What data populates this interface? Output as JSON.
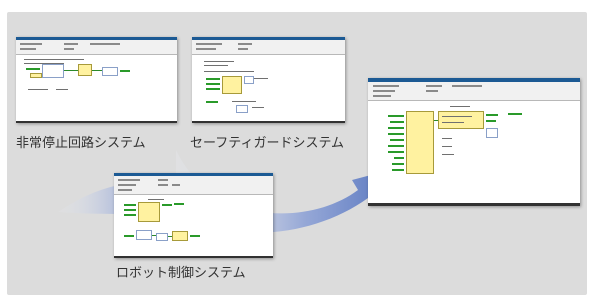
{
  "labels": {
    "emergency_stop": "非常停止回路システム",
    "safety_guard": "セーフティガードシステム",
    "robot_control": "ロボット制御システム"
  },
  "colors": {
    "panel_background": "#dcdcdc",
    "arrow_gradient_start": "#e8ecf6",
    "arrow_gradient_end": "#5a78c0",
    "function_block": "#fff2a0",
    "window_titlebar": "#1c5a94"
  }
}
